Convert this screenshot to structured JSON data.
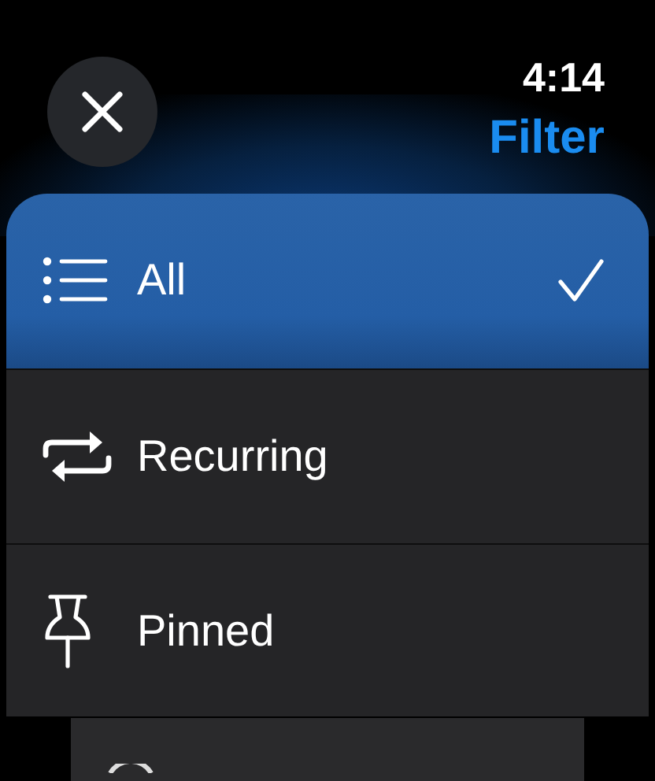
{
  "header": {
    "time": "4:14",
    "title": "Filter"
  },
  "filters": [
    {
      "label": "All",
      "kind": "list",
      "selected": true
    },
    {
      "label": "Recurring",
      "kind": "repeat",
      "selected": false
    },
    {
      "label": "Pinned",
      "kind": "pin",
      "selected": false
    }
  ]
}
